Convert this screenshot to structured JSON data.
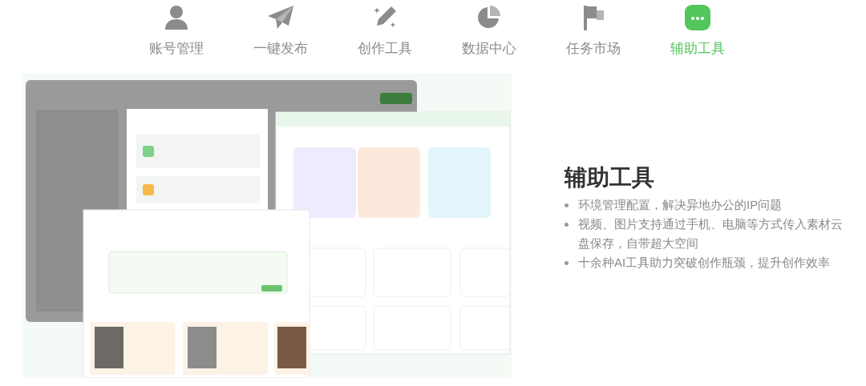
{
  "tabs": [
    {
      "kind": "account",
      "label": "账号管理",
      "selected": false
    },
    {
      "kind": "publish",
      "label": "一键发布",
      "selected": false
    },
    {
      "kind": "create",
      "label": "创作工具",
      "selected": false
    },
    {
      "kind": "data",
      "label": "数据中心",
      "selected": false
    },
    {
      "kind": "task",
      "label": "任务市场",
      "selected": false
    },
    {
      "kind": "assist",
      "label": "辅助工具",
      "selected": true
    }
  ],
  "feature": {
    "title": "辅助工具",
    "bullets": [
      "环境管理配置，解决异地办公的IP问题",
      "视频、图片支持通过手机、电脑等方式传入素材云盘保存，自带超大空间",
      "十余种AI工具助力突破创作瓶颈，提升创作效率"
    ]
  }
}
